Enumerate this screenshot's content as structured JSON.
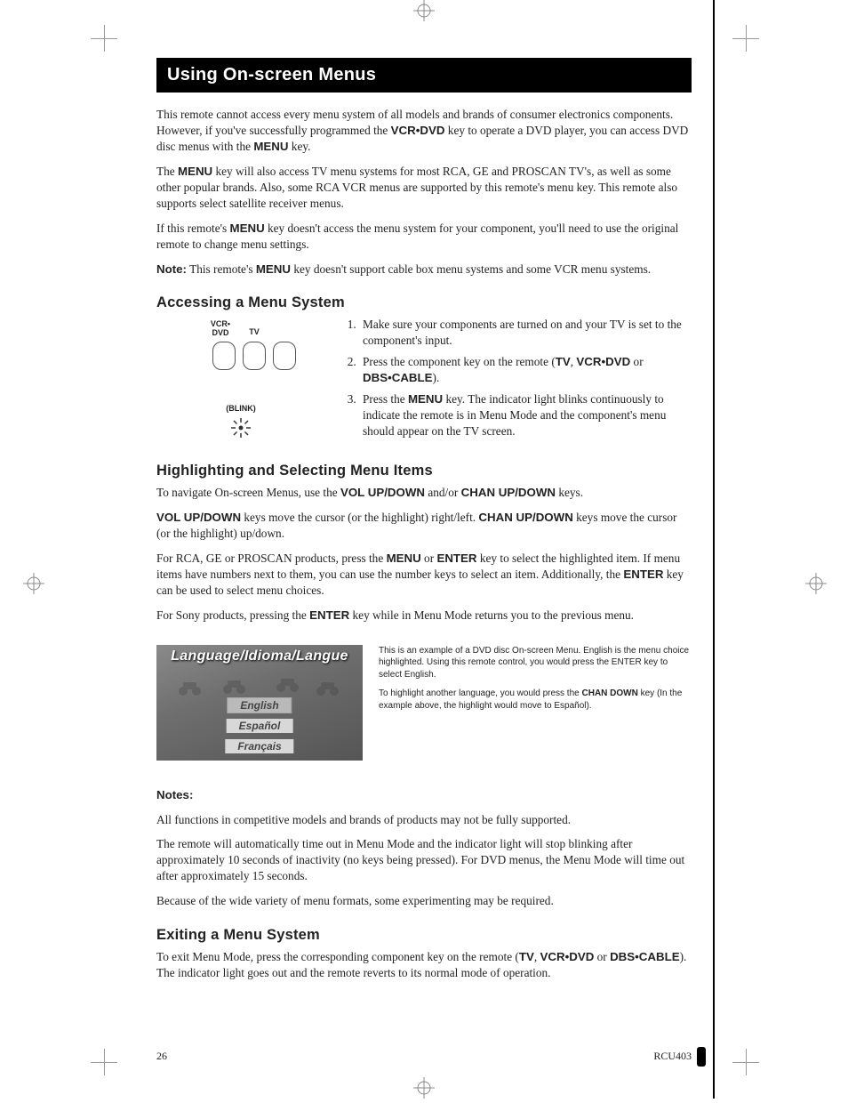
{
  "header": {
    "title": "Using On-screen Menus"
  },
  "intro": {
    "p1_a": "This remote cannot access every menu system of all models and brands of consumer electronics components. However, if you've successfully programmed the ",
    "p1_b": "VCR•DVD",
    "p1_c": " key to operate a DVD player, you can access DVD disc menus with the ",
    "p1_d": "MENU",
    "p1_e": " key.",
    "p2_a": "The ",
    "p2_b": "MENU",
    "p2_c": " key will also access TV menu systems for most RCA, GE and PROSCAN TV's, as well as some other popular brands. Also, some RCA VCR menus are supported by this remote's menu key. This remote also supports select satellite receiver menus.",
    "p3_a": "If this remote's ",
    "p3_b": "MENU",
    "p3_c": " key doesn't access the menu system for your component, you'll need to use the original remote to change menu settings.",
    "p4_a": "Note:",
    "p4_b": " This remote's ",
    "p4_c": "MENU",
    "p4_d": " key doesn't support cable box menu systems and some VCR menu systems."
  },
  "accessing": {
    "heading": "Accessing a Menu System",
    "label_vcr": "VCR•\nDVD",
    "label_tv": "TV",
    "blink": "(BLINK)",
    "step1": "Make sure your components are turned on and your TV is set to the component's input.",
    "step2_a": "Press the component key on the remote (",
    "step2_b": "TV",
    "step2_c": ", ",
    "step2_d": "VCR•DVD",
    "step2_e": " or ",
    "step2_f": "DBS•CABLE",
    "step2_g": ").",
    "step3_a": "Press the ",
    "step3_b": "MENU",
    "step3_c": " key. The indicator light blinks continuously to indicate the remote is in Menu Mode and the component's menu should appear on the TV screen."
  },
  "highlighting": {
    "heading": "Highlighting and Selecting Menu Items",
    "p1_a": "To navigate On-screen Menus, use the ",
    "p1_b": "VOL UP/DOWN",
    "p1_c": " and/or ",
    "p1_d": "CHAN UP/DOWN",
    "p1_e": " keys.",
    "p2_a": "VOL UP/DOWN",
    "p2_b": " keys move the cursor (or the highlight) right/left. ",
    "p2_c": "CHAN UP/DOWN",
    "p2_d": " keys move the cursor (or the highlight) up/down.",
    "p3_a": "For RCA, GE or PROSCAN products, press the ",
    "p3_b": "MENU",
    "p3_c": " or ",
    "p3_d": "ENTER",
    "p3_e": " key to select the highlighted item. If menu items have numbers next to them, you can use the number keys to select an item. Additionally, the ",
    "p3_f": "ENTER",
    "p3_g": " key can be used to select menu choices.",
    "p4_a": "For Sony products, pressing the ",
    "p4_b": "ENTER",
    "p4_c": " key while in Menu Mode returns you to the previous menu."
  },
  "dvd_example": {
    "title": "Language/Idioma/Langue",
    "options": [
      "English",
      "Español",
      "Français"
    ],
    "caption1": "This is an example of a DVD disc On-screen Menu. English is the menu choice highlighted. Using this remote control, you would press the ENTER key to select English.",
    "caption2_a": "To highlight another language, you would press the ",
    "caption2_b": "CHAN DOWN",
    "caption2_c": " key (In the example above, the highlight would move to Español)."
  },
  "notes": {
    "heading": "Notes:",
    "p1": "All functions in competitive models and brands of products may not be fully supported.",
    "p2": "The remote will automatically time out in Menu Mode and the indicator light will stop blinking after approximately 10 seconds of inactivity (no keys being pressed). For DVD menus, the Menu Mode will time out after approximately 15 seconds.",
    "p3": "Because of the wide variety of menu formats, some experimenting may be required."
  },
  "exiting": {
    "heading": "Exiting a Menu System",
    "p1_a": "To exit Menu Mode, press the corresponding component key on the remote (",
    "p1_b": "TV",
    "p1_c": ", ",
    "p1_d": "VCR•DVD",
    "p1_e": " or ",
    "p1_f": "DBS•CABLE",
    "p1_g": "). The indicator light goes out and the remote reverts to its normal mode of operation."
  },
  "footer": {
    "page": "26",
    "model": "RCU403"
  }
}
